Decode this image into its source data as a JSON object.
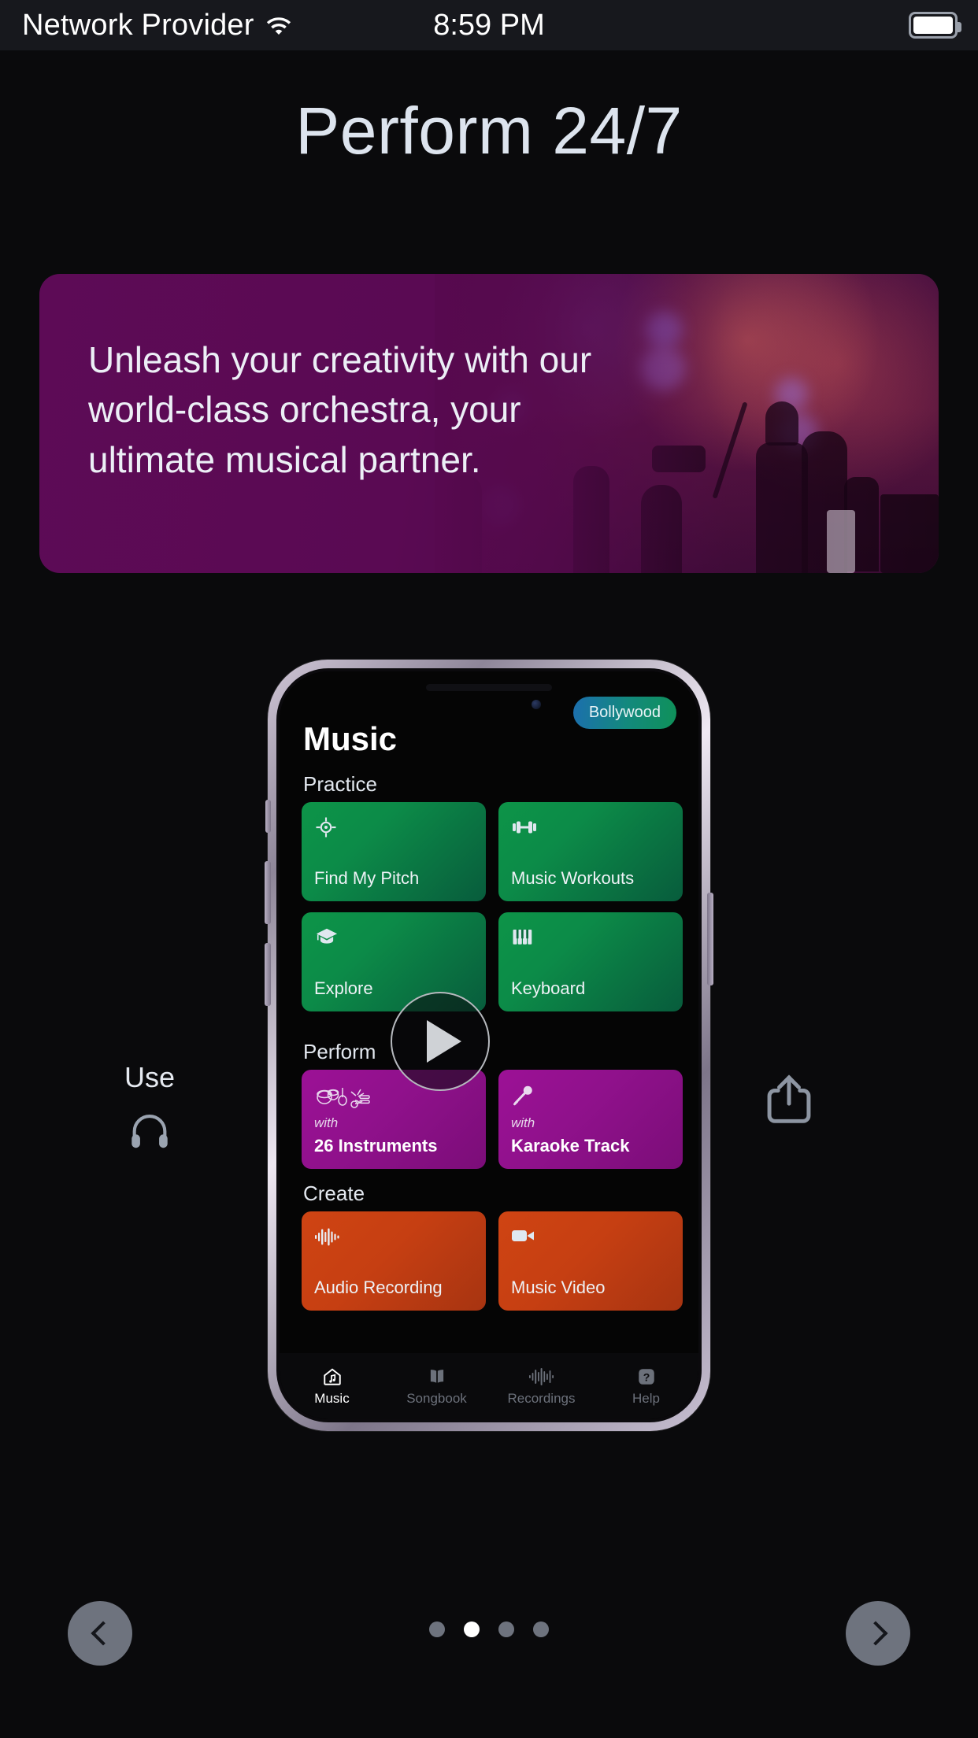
{
  "status_bar": {
    "carrier": "Network Provider",
    "time": "8:59 PM",
    "wifi_icon": "wifi-icon",
    "battery_icon": "battery-full-icon"
  },
  "hero": {
    "title": "Perform 24/7"
  },
  "banner": {
    "text": "Unleash your creativity with our world-class orchestra, your ultimate musical partner.",
    "background_color": "#5d0b56",
    "photo_description": "concert-stage-silhouette"
  },
  "phone_preview": {
    "badge": "Bollywood",
    "app_title": "Music",
    "sections": [
      {
        "label": "Practice",
        "color": "#0d9448",
        "cards": [
          {
            "icon": "crosshair-target-icon",
            "with": "",
            "label": "Find My Pitch"
          },
          {
            "icon": "dumbbell-icon",
            "with": "",
            "label": "Music Workouts"
          }
        ]
      },
      {
        "label": "",
        "color": "#0d9448",
        "cards": [
          {
            "icon": "graduation-cap-icon",
            "with": "",
            "label": "Explore"
          },
          {
            "icon": "piano-keys-icon",
            "with": "",
            "label": "Keyboard"
          }
        ]
      },
      {
        "label": "Perform",
        "color": "#9c1196",
        "cards": [
          {
            "icon": "instruments-icon",
            "with": "with",
            "label": "26 Instruments"
          },
          {
            "icon": "microphone-icon",
            "with": "with",
            "label": "Karaoke Track"
          }
        ]
      },
      {
        "label": "Create",
        "color": "#cf4413",
        "cards": [
          {
            "icon": "waveform-icon",
            "with": "",
            "label": "Audio Recording"
          },
          {
            "icon": "video-camera-icon",
            "with": "",
            "label": "Music Video"
          }
        ]
      }
    ],
    "tabs": [
      {
        "icon": "home-music-icon",
        "label": "Music",
        "active": true
      },
      {
        "icon": "songbook-icon",
        "label": "Songbook",
        "active": false
      },
      {
        "icon": "recordings-waveform-icon",
        "label": "Recordings",
        "active": false
      },
      {
        "icon": "help-question-icon",
        "label": "Help",
        "active": false
      }
    ]
  },
  "overlay": {
    "play_icon": "play-icon"
  },
  "side_hints": {
    "use_label": "Use",
    "headphones_icon": "headphones-icon",
    "share_icon": "share-icon"
  },
  "carousel": {
    "prev_icon": "chevron-left-icon",
    "next_icon": "chevron-right-icon",
    "total_pages": 4,
    "current_page": 2
  }
}
